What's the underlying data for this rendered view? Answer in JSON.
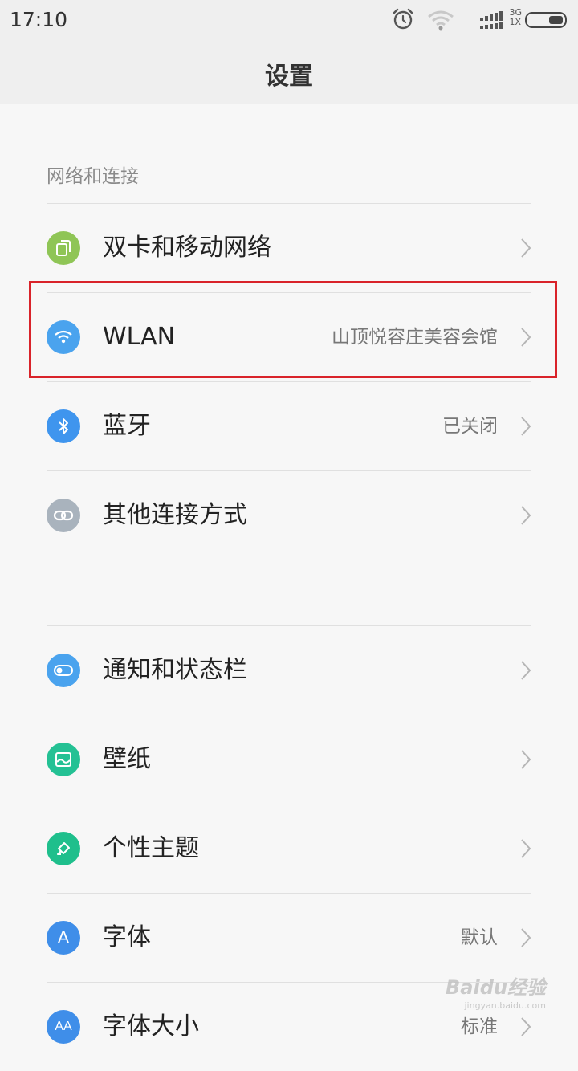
{
  "status_bar": {
    "time": "17:10",
    "network_top": "3G",
    "network_bottom": "1X",
    "icons": [
      "alarm-icon",
      "wifi-icon",
      "signal-icon",
      "battery-icon"
    ]
  },
  "header": {
    "title": "设置"
  },
  "sections": [
    {
      "title": "网络和连接",
      "items": [
        {
          "label": "双卡和移动网络",
          "value": "",
          "icon": "sim-icon",
          "color": "#8fc556"
        },
        {
          "label": "WLAN",
          "value": "山顶悦容庄美容会馆",
          "icon": "wifi-icon",
          "color": "#4aa3ee"
        },
        {
          "label": "蓝牙",
          "value": "已关闭",
          "icon": "bluetooth-icon",
          "color": "#3f95ee"
        },
        {
          "label": "其他连接方式",
          "value": "",
          "icon": "link-icon",
          "color": "#a9b3bd"
        }
      ]
    },
    {
      "title": "",
      "items": [
        {
          "label": "通知和状态栏",
          "value": "",
          "icon": "toggle-icon",
          "color": "#4aa3ee"
        },
        {
          "label": "壁纸",
          "value": "",
          "icon": "wallpaper-icon",
          "color": "#24c194"
        },
        {
          "label": "个性主题",
          "value": "",
          "icon": "brush-icon",
          "color": "#1fbf8c"
        },
        {
          "label": "字体",
          "value": "默认",
          "icon": "font-icon",
          "color": "#3f8ee9"
        },
        {
          "label": "字体大小",
          "value": "标准",
          "icon": "font-size-icon",
          "color": "#3f8ee9"
        }
      ]
    }
  ],
  "watermark": {
    "text": "Baidu经验",
    "url_text": "jingyan.baidu.com"
  },
  "colors": {
    "highlight": "#d9232a",
    "background": "#f7f7f7",
    "header_bg": "#efefef"
  }
}
